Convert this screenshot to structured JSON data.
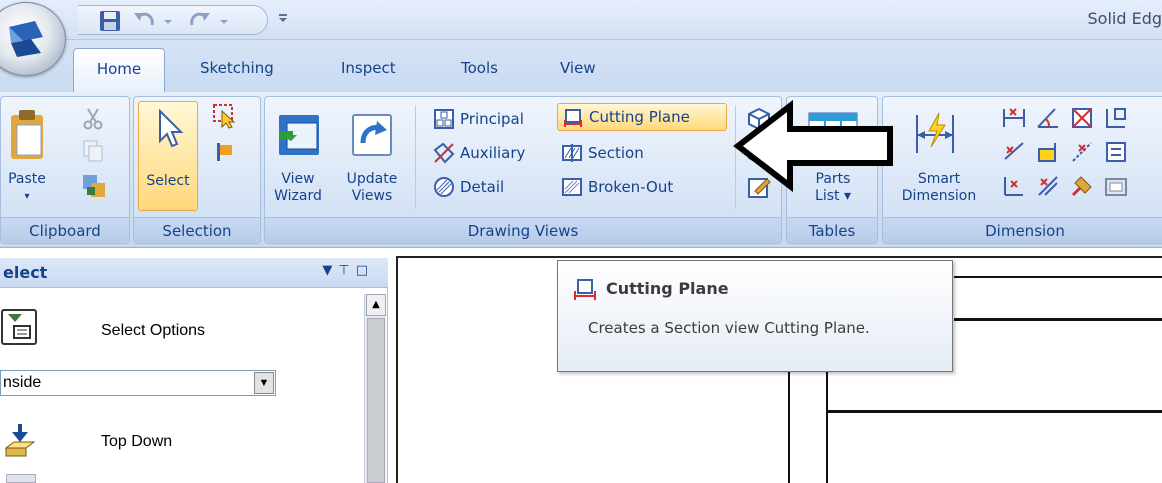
{
  "app": {
    "title": "Solid Edg"
  },
  "tabs": [
    "Home",
    "Sketching",
    "Inspect",
    "Tools",
    "View"
  ],
  "ribbon": {
    "clipboard": {
      "label": "Clipboard",
      "paste": "Paste"
    },
    "selection": {
      "label": "Selection",
      "select": "Select"
    },
    "drawing_views": {
      "label": "Drawing Views",
      "view_wizard": [
        "View",
        "Wizard"
      ],
      "update_views": [
        "Update",
        "Views"
      ],
      "principal": "Principal",
      "auxiliary": "Auxiliary",
      "detail": "Detail",
      "cutting_plane": "Cutting Plane",
      "section": "Section",
      "broken_out": "Broken-Out"
    },
    "tables": {
      "label": "Tables",
      "parts_list": [
        "Parts",
        "List ▾"
      ]
    },
    "dimension": {
      "label": "Dimension",
      "smart_dimension": [
        "Smart",
        "Dimension"
      ]
    }
  },
  "panel": {
    "title": "elect",
    "select_options": "Select Options",
    "combo_value": "nside",
    "top_down": "Top Down"
  },
  "tooltip": {
    "title": "Cutting Plane",
    "description": "Creates a Section view Cutting Plane."
  },
  "colors": {
    "accent": "#15428b",
    "highlight": "#ffd87a"
  }
}
